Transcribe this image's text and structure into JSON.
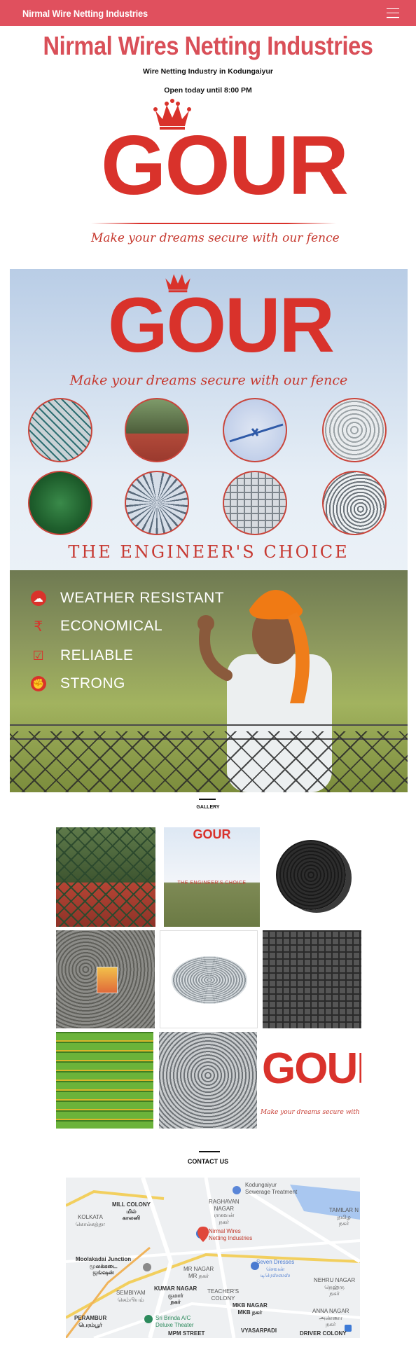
{
  "navbar": {
    "brand": "Nirmal Wire Netting Industries",
    "menu_icon": "hamburger-menu-icon"
  },
  "header": {
    "title": "Nirmal Wires Netting Industries",
    "subtitle": "Wire Netting Industry in Kodungaiyur",
    "hours": "Open today until 8:00 PM"
  },
  "logo": {
    "word": "GOUR",
    "tagline": "Make your dreams secure with our fence",
    "color": "#d9322b"
  },
  "banner": {
    "word": "GOUR",
    "tagline": "Make your dreams secure with our fence",
    "slogan": "THE ENGINEER'S CHOICE",
    "features": [
      {
        "label": "WEATHER RESISTANT",
        "icon": "cloud-icon",
        "color": "#d9322b"
      },
      {
        "label": "ECONOMICAL",
        "icon": "rupee-icon",
        "color": "#d9322b"
      },
      {
        "label": "RELIABLE",
        "icon": "checklist-icon",
        "color": "#d9322b"
      },
      {
        "label": "STRONG",
        "icon": "strength-icon",
        "color": "#d9322b"
      }
    ],
    "products": [
      "chain-link-mesh",
      "chain-link-fence",
      "barbed-wire",
      "hexagonal-mesh",
      "pvc-coated-wire-coil",
      "concertina-wire",
      "welded-mesh",
      "gi-wire-coil"
    ]
  },
  "gallery": {
    "heading": "GALLERY",
    "items": [
      "chain-link-fence-photo",
      "gour-poster-photo",
      "black-wire-coil-photo",
      "hexagonal-mesh-rolls-photo",
      "gi-wire-coil-photo",
      "welded-mesh-rolls-photo",
      "green-pvc-wire-photo",
      "barbed-wire-rolls-photo",
      "gour-logo-photo"
    ]
  },
  "contact": {
    "heading": "CONTACT US",
    "map": {
      "pin_label": "Nirmal Wires\nNetting Industries",
      "labels": [
        "Kodungaiyur\nSewerage Treatment",
        "MILL COLONY\nமில்\nகாலனி",
        "RAGHAVAN\nNAGAR\nராகவன்\nநகர்",
        "KOLKATA\nகொல்கத்தா",
        "TAMILAR N\nதமிழ\nநகர்",
        "Moolakadai Junction\nமூலக்கடை\nஜங்ஷன்",
        "MR NAGAR\nMR நகர்",
        "Seven Dresses\nசெவன்\nடிரெஸ்ஸஸ்",
        "KUMAR NAGAR\nகுமார்\nநகர்",
        "NEHRU NAGAR\nநெஹ்ரு\nநகர்",
        "SEMBIYAM\nசெம்பியம்",
        "TEACHER'S\nCOLONY",
        "MKB NAGAR\nMKB நகர்",
        "PERAMBUR\nபெரம்பூர்",
        "Sri Brinda A/C\nDeluxe Theater",
        "ANNA NAGAR\nஅண்ணா\nநகர்",
        "MPM STREET",
        "VYASARPADI",
        "DRIVER COLONY"
      ]
    }
  }
}
